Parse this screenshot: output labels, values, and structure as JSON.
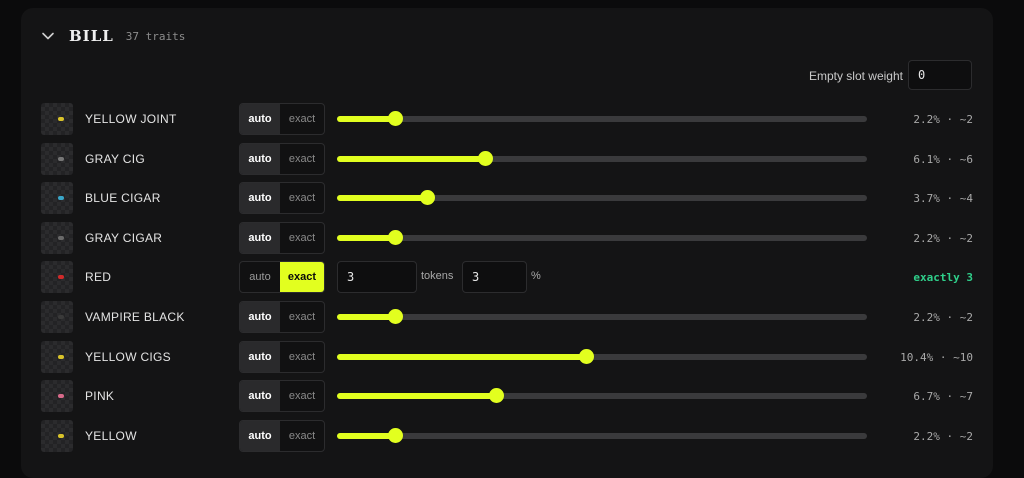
{
  "group": {
    "title": "BILL",
    "trait_count": "37 traits"
  },
  "empty_slot": {
    "label": "Empty slot weight",
    "value": "0"
  },
  "toggle_labels": {
    "auto": "auto",
    "exact": "exact"
  },
  "traits": [
    {
      "name": "YELLOW JOINT",
      "mode": "auto",
      "weight": 0.11,
      "stat": "2.2% · ~2",
      "icon_color": "#d9c32a"
    },
    {
      "name": "GRAY CIG",
      "mode": "auto",
      "weight": 0.28,
      "stat": "6.1% · ~6",
      "icon_color": "#777777"
    },
    {
      "name": "BLUE CIGAR",
      "mode": "auto",
      "weight": 0.17,
      "stat": "3.7% · ~4",
      "icon_color": "#3aa6c8"
    },
    {
      "name": "GRAY CIGAR",
      "mode": "auto",
      "weight": 0.11,
      "stat": "2.2% · ~2",
      "icon_color": "#6a6a6a"
    },
    {
      "name": "RED",
      "mode": "exact",
      "tokens": "3",
      "tokens_label": "tokens",
      "percent": "3",
      "percent_label": "%",
      "stat": "exactly 3",
      "icon_color": "#d12a2a"
    },
    {
      "name": "VAMPIRE BLACK",
      "mode": "auto",
      "weight": 0.11,
      "stat": "2.2% · ~2",
      "icon_color": "#3a3a3a"
    },
    {
      "name": "YELLOW CIGS",
      "mode": "auto",
      "weight": 0.47,
      "stat": "10.4% · ~10",
      "icon_color": "#d9c32a"
    },
    {
      "name": "PINK",
      "mode": "auto",
      "weight": 0.3,
      "stat": "6.7% · ~7",
      "icon_color": "#d86a8a"
    },
    {
      "name": "YELLOW",
      "mode": "auto",
      "weight": 0.11,
      "stat": "2.2% · ~2",
      "icon_color": "#d9c32a"
    }
  ]
}
